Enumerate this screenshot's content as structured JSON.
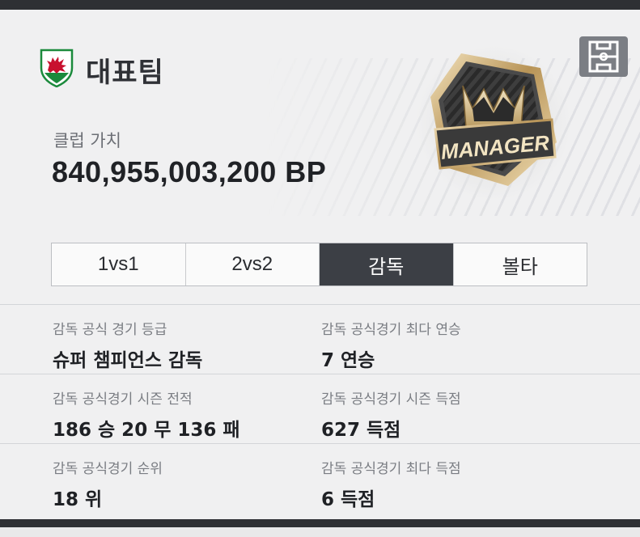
{
  "team": {
    "name": "대표팀",
    "crest_icon": "wales-dragon-crest-icon",
    "club_value_label": "클럽 가치",
    "club_value": "840,955,003,200 BP"
  },
  "badge": {
    "text": "MANAGER",
    "icon": "manager-crown-badge-icon"
  },
  "field_button": {
    "icon": "formation-field-icon"
  },
  "tabs": [
    {
      "label": "1vs1",
      "active": false
    },
    {
      "label": "2vs2",
      "active": false
    },
    {
      "label": "감독",
      "active": true
    },
    {
      "label": "볼타",
      "active": false
    }
  ],
  "stats": [
    {
      "left": {
        "label": "감독 공식 경기 등급",
        "value": "슈퍼 챔피언스 감독"
      },
      "right": {
        "label": "감독 공식경기 최다 연승",
        "value": "7 연승"
      }
    },
    {
      "left": {
        "label": "감독 공식경기 시즌 전적",
        "value": "186 승 20 무 136 패"
      },
      "right": {
        "label": "감독 공식경기 시즌 득점",
        "value": "627 득점"
      }
    },
    {
      "left": {
        "label": "감독 공식경기 순위",
        "value": "18 위"
      },
      "right": {
        "label": "감독 공식경기 최다 득점",
        "value": "6 득점"
      }
    }
  ],
  "colors": {
    "panel_bg": "#f0f0f1",
    "frame_dark": "#2e3034",
    "tab_active_bg": "#3c3f45",
    "crest_red": "#c8102e",
    "crest_green": "#1b8a3c",
    "badge_gold": "#c9a86a"
  }
}
